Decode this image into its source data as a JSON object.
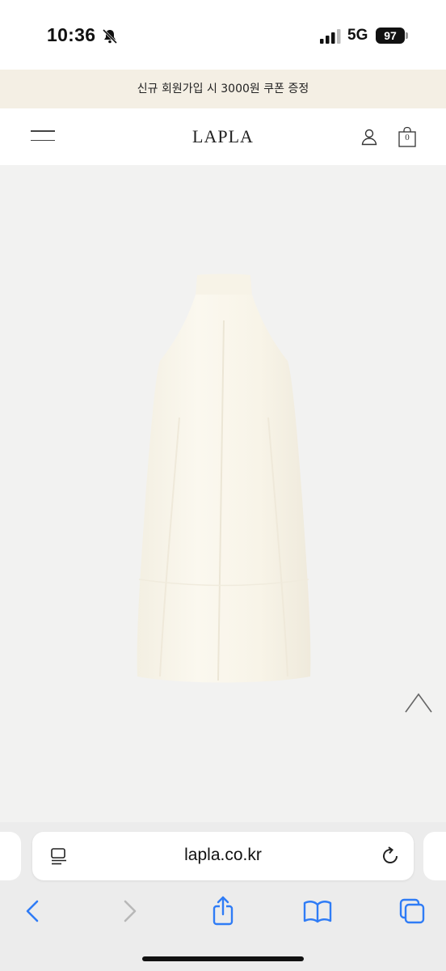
{
  "status_bar": {
    "time": "10:36",
    "network": "5G",
    "battery": "97"
  },
  "promo": {
    "text": "신규 회원가입 시 3000원 쿠폰 증정"
  },
  "header": {
    "logo": "LAPLA",
    "cart_count": "0"
  },
  "product": {
    "image_icon": "dress-image",
    "color": "#f8f5ea"
  },
  "browser": {
    "url": "lapla.co.kr",
    "accent": "#2f7cf6"
  },
  "icons": {
    "menu": "hamburger-icon",
    "user": "user-icon",
    "cart": "shopping-bag-icon",
    "scroll_top": "chevron-up-icon",
    "reader": "reader-icon",
    "reload": "reload-icon",
    "back": "chevron-left-icon",
    "forward": "chevron-right-icon",
    "share": "share-icon",
    "bookmarks": "book-icon",
    "tabs": "tabs-icon"
  }
}
